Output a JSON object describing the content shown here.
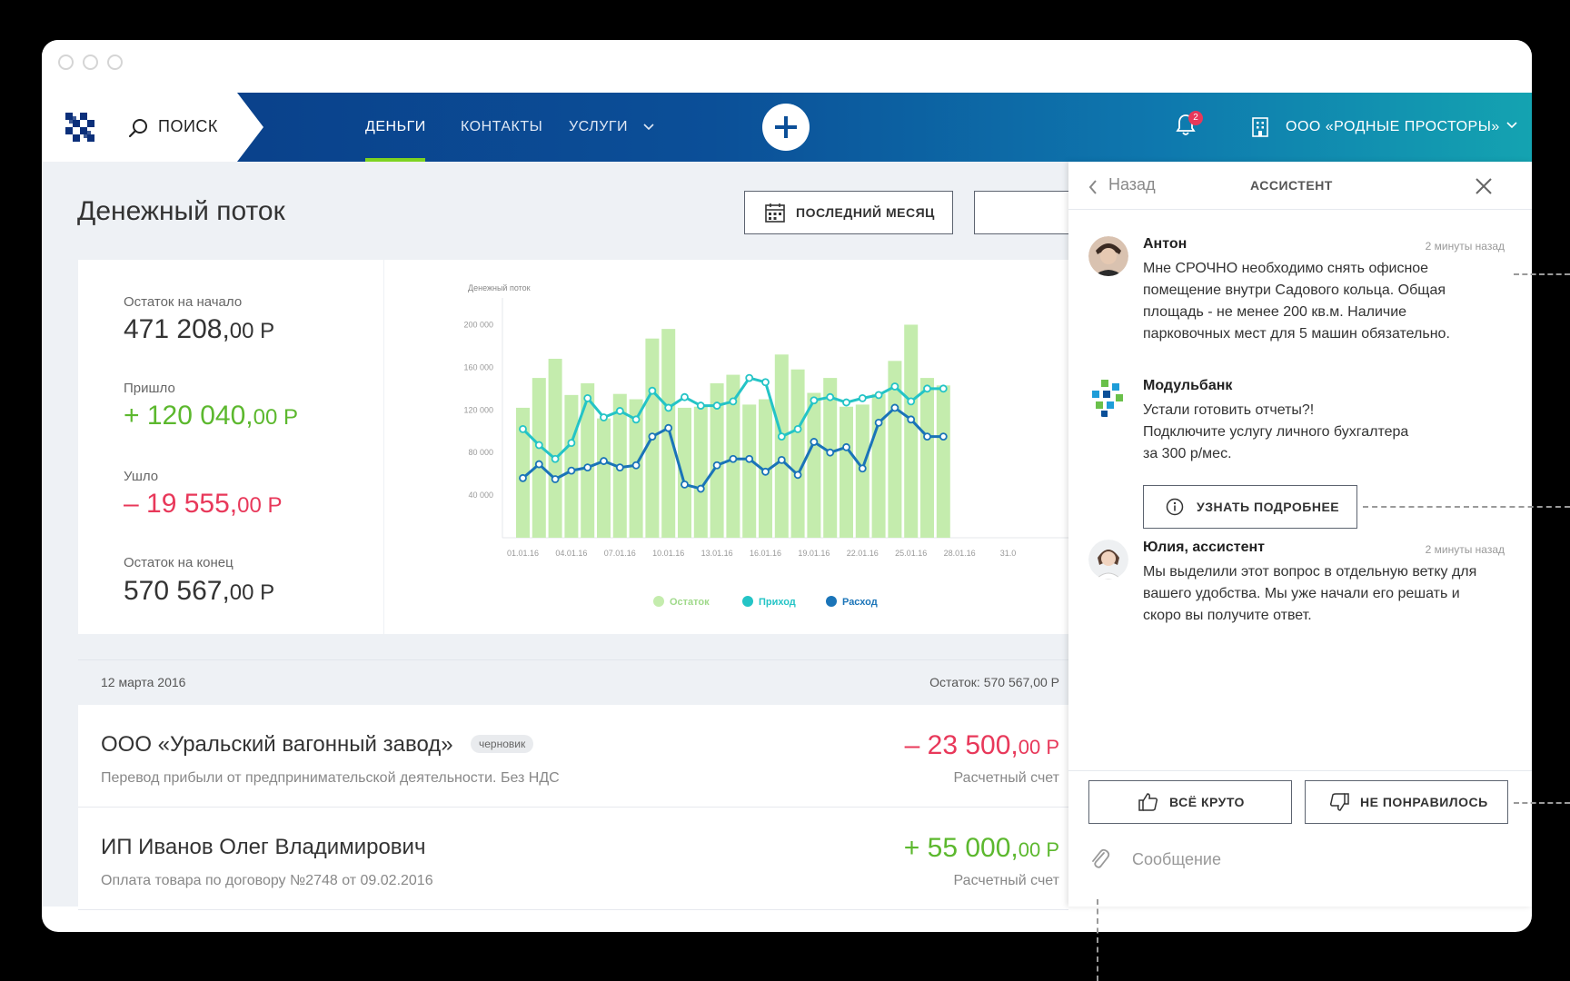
{
  "header": {
    "search_label": "ПОИСК",
    "nav": [
      {
        "label": "ДЕНЬГИ",
        "active": true
      },
      {
        "label": "КОНТАКТЫ",
        "active": false
      },
      {
        "label": "УСЛУГИ",
        "active": false
      }
    ],
    "notifications_count": "2",
    "company": "ООО «РОДНЫЕ ПРОСТОРЫ»"
  },
  "colors": {
    "accent_green": "#7ed321",
    "income_green": "#5cb82e",
    "expense_red": "#e8385a",
    "series_ostatok": "#c4ecad",
    "series_prihod": "#24c4c6",
    "series_rashod": "#1a74b8"
  },
  "page": {
    "title": "Денежный поток",
    "period_button": "ПОСЛЕДНИЙ МЕСЯЦ"
  },
  "summary": {
    "start_label": "Остаток на начало",
    "start_value": "471 208,",
    "start_cents": "00 Р",
    "in_label": "Пришло",
    "in_value": "+ 120 040,",
    "in_cents": "00 Р",
    "out_label": "Ушло",
    "out_value": "– 19 555,",
    "out_cents": "00 Р",
    "end_label": "Остаток  на конец",
    "end_value": "570 567,",
    "end_cents": "00 Р"
  },
  "chart_data": {
    "type": "bar",
    "title": "Денежный поток",
    "ylim": [
      0,
      220000
    ],
    "yticks": [
      "40 000",
      "80 000",
      "120 000",
      "160 000",
      "200 000"
    ],
    "xtick_labels": [
      "01.01.16",
      "04.01.16",
      "07.01.16",
      "10.01.16",
      "13.01.16",
      "16.01.16",
      "19.01.16",
      "22.01.16",
      "25.01.16",
      "28.01.16",
      "31.0"
    ],
    "grid": false,
    "legend_placement": "bottom",
    "series": [
      {
        "name": "Остаток",
        "kind": "bar",
        "values": [
          122000,
          150000,
          168000,
          134000,
          145000,
          112000,
          135000,
          130000,
          187000,
          196000,
          122000,
          123000,
          145000,
          153000,
          125000,
          130000,
          172000,
          158000,
          136000,
          150000,
          123000,
          125000,
          135000,
          166000,
          200000,
          150000,
          143000
        ]
      },
      {
        "name": "Приход",
        "kind": "line",
        "values": [
          102000,
          87000,
          74000,
          89000,
          131000,
          113000,
          119000,
          111000,
          138000,
          122000,
          132000,
          124000,
          124000,
          128000,
          150000,
          146000,
          95000,
          102000,
          129000,
          132000,
          127000,
          131000,
          134000,
          142000,
          128000,
          140000,
          140000
        ]
      },
      {
        "name": "Расход",
        "kind": "line",
        "values": [
          56000,
          69000,
          55000,
          63000,
          66000,
          72000,
          66000,
          68000,
          95000,
          103000,
          50000,
          46000,
          68000,
          74000,
          74000,
          62000,
          73000,
          59000,
          90000,
          80000,
          85000,
          65000,
          108000,
          122000,
          111000,
          95000,
          95000
        ]
      }
    ]
  },
  "transactions": {
    "date": "12 марта 2016",
    "balance": "Остаток: 570 567,00 Р",
    "rows": [
      {
        "name": "ООО «Уральский вагонный завод»",
        "badge": "черновик",
        "desc": "Перевод прибыли от предпринимательской деятельности. Без НДС",
        "amount": "– 23 500,",
        "cents": "00 Р",
        "account": "Расчетный счет"
      },
      {
        "name": "ИП Иванов Олег Владимирович",
        "badge": "",
        "desc": "Оплата товара по договору №2748 от 09.02.2016",
        "amount": "+ 55 000,",
        "cents": "00 Р",
        "account": "Расчетный счет"
      }
    ]
  },
  "assistant": {
    "back_label": "Назад",
    "title": "АССИСТЕНТ",
    "messages": [
      {
        "name": "Антон",
        "time": "2 минуты назад",
        "text": "Мне СРОЧНО необходимо снять офисное помещение внутри Садового кольца. Общая площадь - не менее 200 кв.м. Наличие парковочных мест для 5 машин обязательно."
      },
      {
        "name": "Модульбанк",
        "time": "",
        "text_lines": [
          "Устали готовить отчеты?!",
          "Подключите услугу личного бухгалтера",
          "за 300 р/мес."
        ]
      },
      {
        "name": "Юлия, ассистент",
        "time": "2 минуты назад",
        "text": "Мы выделили этот вопрос в отдельную ветку для вашего удобства. Мы уже начали его решать и скоро вы получите ответ."
      }
    ],
    "more_button": "УЗНАТЬ ПОДРОБНЕЕ",
    "like_button": "ВСЁ КРУТО",
    "dislike_button": "НЕ ПОНРАВИЛОСЬ",
    "message_placeholder": "Сообщение"
  }
}
